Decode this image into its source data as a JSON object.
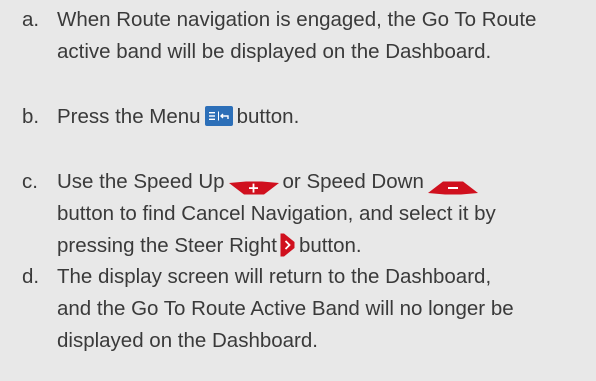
{
  "steps": [
    {
      "letter": "a.",
      "lines": [
        "When Route navigation is engaged, the Go To Route",
        "active band will be displayed on the Dashboard."
      ]
    },
    {
      "letter": "b.",
      "before_menu": "Press the Menu",
      "after_menu": "button."
    },
    {
      "letter": "c.",
      "part1": "Use the Speed Up",
      "part2": "or Speed Down",
      "line2": "button to find Cancel Navigation, and select it by",
      "line3_before": "pressing the Steer Right",
      "line3_after": "button."
    },
    {
      "letter": "d.",
      "lines": [
        "The display screen will return to the Dashboard,",
        "and the Go To Route Active Band will no longer be",
        "displayed on the Dashboard."
      ]
    }
  ],
  "icons": {
    "menu": "menu-icon",
    "speed_up": "speed-up-icon",
    "speed_down": "speed-down-icon",
    "steer_right": "steer-right-icon"
  },
  "colors": {
    "background": "#e8e8e8",
    "text": "#3a3a3a",
    "menu_button": "#2c6fb8",
    "speed_button": "#d0101e",
    "steer_button": "#d0101e"
  }
}
